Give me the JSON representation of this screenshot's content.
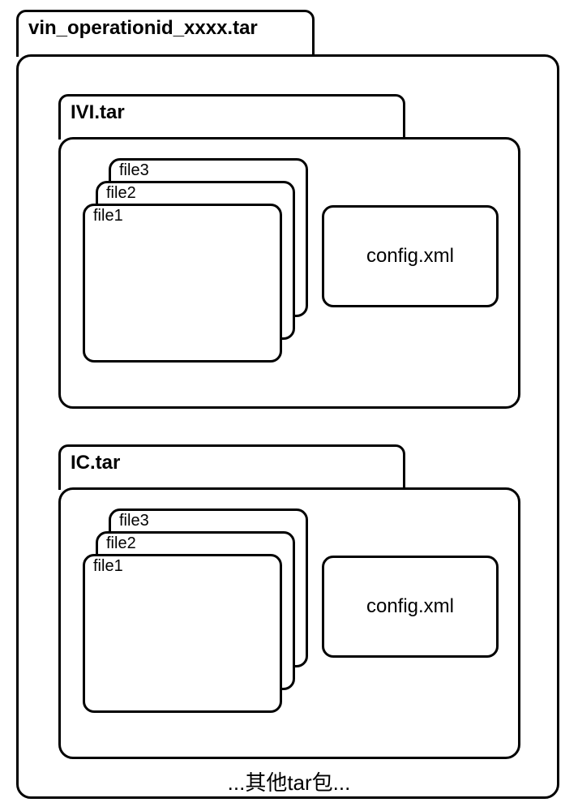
{
  "outer": {
    "title": "vin_operationid_xxxx.tar"
  },
  "inner1": {
    "title": "IVI.tar",
    "files": {
      "f1": "file1",
      "f2": "file2",
      "f3": "file3"
    },
    "config": "config.xml"
  },
  "inner2": {
    "title": "IC.tar",
    "files": {
      "f1": "file1",
      "f2": "file2",
      "f3": "file3"
    },
    "config": "config.xml"
  },
  "footer": "...其他tar包..."
}
